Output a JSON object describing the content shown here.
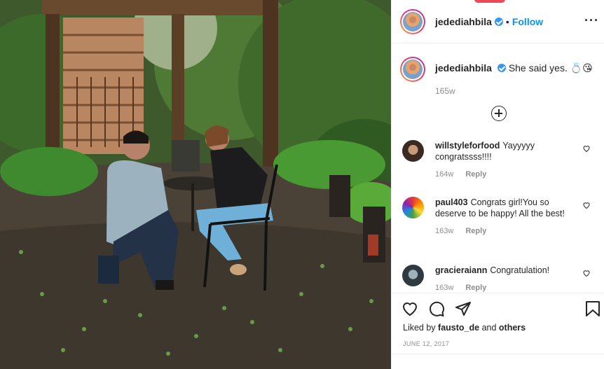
{
  "post_author": {
    "username": "jedediahbila",
    "verified": true,
    "follow_label": "Follow",
    "separator": "•"
  },
  "caption": {
    "username": "jedediahbila",
    "text": "She said yes. 💍😘",
    "time": "165w"
  },
  "comments": [
    {
      "username": "willstyleforfood",
      "text": "Yayyyyy congratssss!!!!",
      "time": "164w",
      "reply_label": "Reply",
      "avatar_color": "#4a3a32"
    },
    {
      "username": "paul403",
      "text": "Congrats girl!You so deserve to be happy! All the best!",
      "time": "163w",
      "reply_label": "Reply",
      "avatar_color": "#8bc34a"
    },
    {
      "username": "gracieraiann",
      "text": "Congratulation!",
      "time": "163w",
      "reply_label": "Reply",
      "avatar_color": "#5b6a73"
    }
  ],
  "likes": {
    "prefix": "Liked by",
    "user": "fausto_de",
    "connector": "and",
    "suffix": "others"
  },
  "date": "JUNE 12, 2017",
  "icons": {
    "more": "more-options-icon",
    "load_more": "plus-circle-icon",
    "like": "heart-icon",
    "comment": "comment-bubble-icon",
    "share": "paper-plane-icon",
    "save": "bookmark-icon"
  },
  "colors": {
    "accent": "#0095f6",
    "verified": "#3897f0",
    "muted": "#8e8e8e",
    "text": "#262626",
    "notification": "#ed4956"
  }
}
